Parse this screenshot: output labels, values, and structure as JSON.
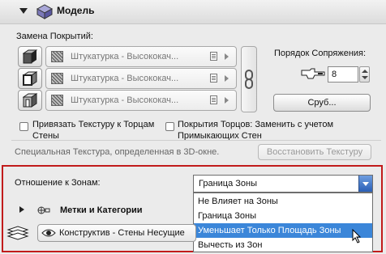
{
  "header": {
    "title": "Модель",
    "icon": "model-cube-icon"
  },
  "surfaces": {
    "label": "Замена Покрытий:",
    "rows": [
      {
        "icon": "surface-top-icon",
        "material": "Штукатурка - Высококач..."
      },
      {
        "icon": "surface-side-icon",
        "material": "Штукатурка - Высококач..."
      },
      {
        "icon": "surface-edge-icon",
        "material": "Штукатурка - Высококач..."
      }
    ]
  },
  "order": {
    "label": "Порядок Сопряжения:",
    "value": "8"
  },
  "cross_button": "Сруб...",
  "checkbox_texture": {
    "line1": "Привязать Текстуру к Торцам",
    "line2": "Стены"
  },
  "checkbox_edges": {
    "line1": "Покрытия Торцов: Заменить с учетом",
    "line2": "Примыкающих Стен"
  },
  "special_texture": "Специальная Текстура, определенная в 3D-окне.",
  "restore_button": "Восстановить Текстуру",
  "zones": {
    "label": "Отношение к Зонам:",
    "selected": "Граница Зоны",
    "options": [
      "Не Влияет на Зоны",
      "Граница Зоны",
      "Уменьшает Только Площадь Зоны",
      "Вычесть из Зон"
    ],
    "highlighted_index": 2
  },
  "tags_section": {
    "title": "Метки и Категории"
  },
  "layer": {
    "value": "Конструктив - Стены Несущие"
  },
  "colors": {
    "highlight_frame": "#c11b1b",
    "selection": "#3b86d9"
  }
}
